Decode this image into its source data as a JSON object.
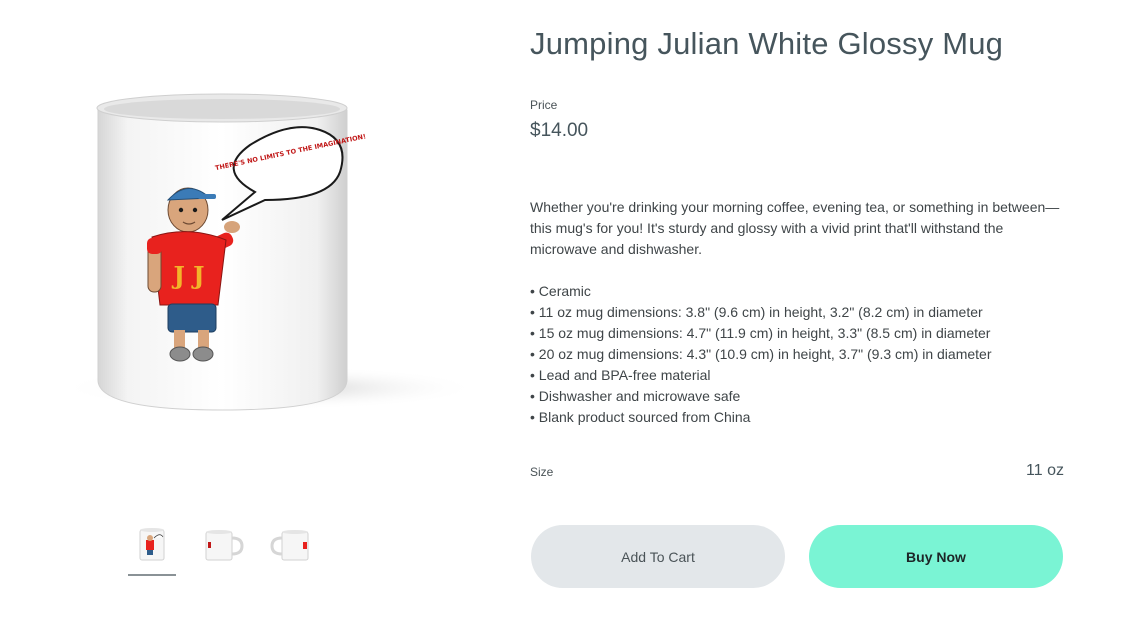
{
  "product": {
    "title": "Jumping Julian White Glossy Mug",
    "price_label": "Price",
    "price": "$14.00",
    "description": "Whether you're drinking your morning coffee, evening tea, or something in between—this mug's for you! It's sturdy and glossy with a vivid print that'll withstand the microwave and dishwasher.",
    "features": [
      "• Ceramic",
      "• 11 oz mug dimensions: 3.8\" (9.6 cm) in height, 3.2\" (8.2 cm) in diameter",
      "• 15 oz mug dimensions: 4.7\" (11.9 cm) in height, 3.3\" (8.5 cm) in diameter",
      "• 20 oz mug dimensions: 4.3\" (10.9 cm) in height, 3.7\" (9.3 cm) in diameter",
      "• Lead and BPA-free material",
      "• Dishwasher and microwave safe",
      "• Blank product sourced from China"
    ],
    "size_label": "Size",
    "size_value": "11 oz"
  },
  "artwork": {
    "speech_bubble": "THERE'S NO LIMITS TO THE IMAGINATION!",
    "shirt_letters": "J J"
  },
  "gallery": {
    "thumbnails": [
      "front-view",
      "side-view",
      "handle-view"
    ],
    "active_index": 0
  },
  "buttons": {
    "add_to_cart": "Add To Cart",
    "buy_now": "Buy Now"
  },
  "colors": {
    "buy_now_bg": "#7af4d4",
    "add_to_cart_bg": "#e3e7ea",
    "title_color": "#46555c",
    "shirt_red": "#e8221e"
  }
}
